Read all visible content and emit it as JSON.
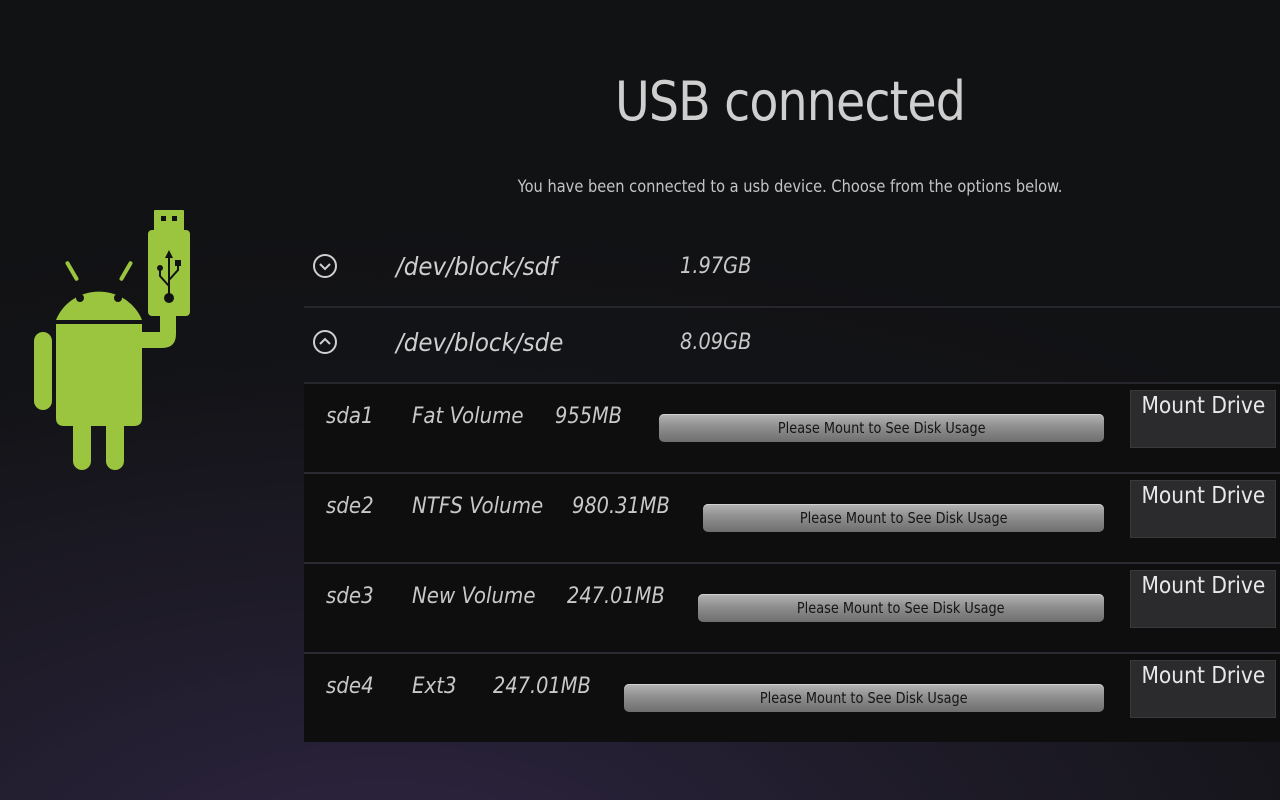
{
  "header": {
    "title": "USB connected",
    "subtitle": "You have been connected to a usb device. Choose from the options below."
  },
  "illustration": {
    "icon": "android-holding-usb-icon",
    "color": "#9bc43f"
  },
  "devices": [
    {
      "path": "/dev/block/sdf",
      "size": "1.97GB",
      "expanded": false,
      "toggle_icon": "chevron-down-circle-icon",
      "partitions": []
    },
    {
      "path": "/dev/block/sde",
      "size": "8.09GB",
      "expanded": true,
      "toggle_icon": "chevron-up-circle-icon",
      "partitions": [
        {
          "id": "sda1",
          "label": "Fat Volume",
          "size": "955MB",
          "usage_text": "Please Mount to See Disk Usage",
          "button": "Mount Drive"
        },
        {
          "id": "sde2",
          "label": "NTFS Volume",
          "size": "980.31MB",
          "usage_text": "Please Mount to See Disk Usage",
          "button": "Mount Drive"
        },
        {
          "id": "sde3",
          "label": "New Volume",
          "size": "247.01MB",
          "usage_text": "Please Mount to See Disk Usage",
          "button": "Mount Drive"
        },
        {
          "id": "sde4",
          "label": "Ext3",
          "size": "247.01MB",
          "usage_text": "Please Mount to See Disk Usage",
          "button": "Mount Drive"
        }
      ]
    }
  ]
}
